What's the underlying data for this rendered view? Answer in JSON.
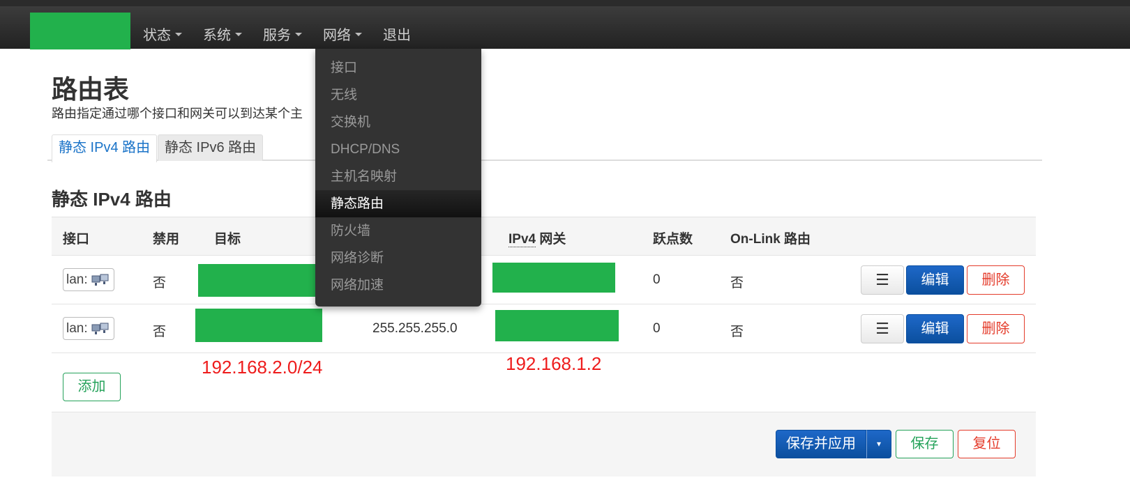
{
  "brand": {
    "color": "#22b14c"
  },
  "nav": {
    "items": [
      {
        "label": "状态",
        "has_caret": true
      },
      {
        "label": "系统",
        "has_caret": true
      },
      {
        "label": "服务",
        "has_caret": true
      },
      {
        "label": "网络",
        "has_caret": true
      },
      {
        "label": "退出",
        "has_caret": false
      }
    ]
  },
  "dropdown": {
    "items": [
      {
        "label": "接口"
      },
      {
        "label": "无线"
      },
      {
        "label": "交换机"
      },
      {
        "label": "DHCP/DNS"
      },
      {
        "label": "主机名映射"
      },
      {
        "label": "静态路由",
        "active": true
      },
      {
        "label": "防火墙"
      },
      {
        "label": "网络诊断"
      },
      {
        "label": "网络加速"
      }
    ]
  },
  "page": {
    "title": "路由表",
    "description": "路由指定通过哪个接口和网关可以到达某个主"
  },
  "tabs": [
    {
      "label": "静态 IPv4 路由",
      "active": true
    },
    {
      "label": "静态 IPv6 路由",
      "active": false
    }
  ],
  "section": {
    "title": "静态 IPv4 路由"
  },
  "table": {
    "headers": {
      "interface": "接口",
      "disabled": "禁用",
      "target": "目标",
      "gateway_abbr": "IPv4",
      "gateway_rest": " 网关",
      "hops": "跃点数",
      "onlink": "On-Link 路由"
    },
    "rows": [
      {
        "interface": "lan:",
        "disabled": "否",
        "netmask": "",
        "hops": "0",
        "onlink": "否"
      },
      {
        "interface": "lan:",
        "disabled": "否",
        "netmask": "255.255.255.0",
        "hops": "0",
        "onlink": "否"
      }
    ],
    "row_buttons": {
      "menu": "☰",
      "edit": "编辑",
      "delete": "删除"
    }
  },
  "annotations": {
    "target": "192.168.2.0/24",
    "gateway": "192.168.1.2"
  },
  "buttons": {
    "add": "添加",
    "save_apply": "保存并应用",
    "save_apply_dropdown": "▾",
    "save": "保存",
    "reset": "复位"
  }
}
